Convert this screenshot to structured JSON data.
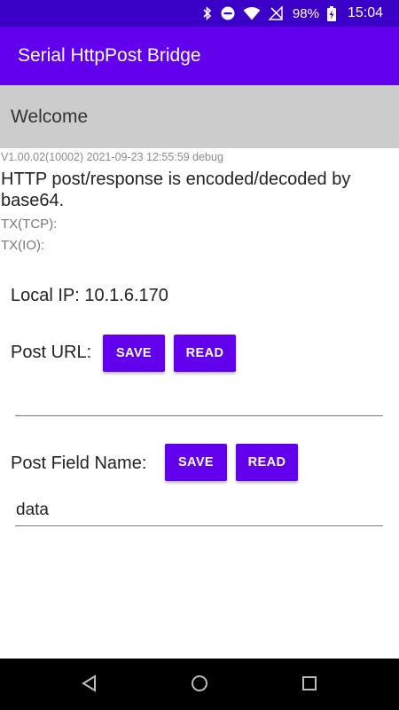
{
  "status_bar": {
    "battery": "98%",
    "time": "15:04",
    "icons": [
      "bluetooth-icon",
      "do-not-disturb-icon",
      "wifi-icon",
      "no-signal-icon",
      "battery-charging-icon"
    ]
  },
  "app_bar": {
    "title": "Serial HttpPost Bridge"
  },
  "welcome": {
    "text": "Welcome"
  },
  "info": {
    "version": "V1.00.02(10002) 2021-09-23 12:55:59 debug",
    "description": "HTTP post/response is encoded/decoded by base64.",
    "tx_tcp": "TX(TCP):",
    "tx_io": "TX(IO):"
  },
  "local_ip": {
    "text": "Local IP: 10.1.6.170"
  },
  "post_url": {
    "label": "Post URL:",
    "save_label": "SAVE",
    "read_label": "READ",
    "value": ""
  },
  "post_field": {
    "label": "Post Field Name:",
    "save_label": "SAVE",
    "read_label": "READ",
    "value": "data"
  },
  "colors": {
    "status_bar": "#3a00c8",
    "app_bar": "#6200ee",
    "button": "#6200ee",
    "welcome_bg": "#cccccc"
  },
  "nav_bar": {
    "icons": [
      "back-icon",
      "home-icon",
      "recents-icon"
    ]
  }
}
